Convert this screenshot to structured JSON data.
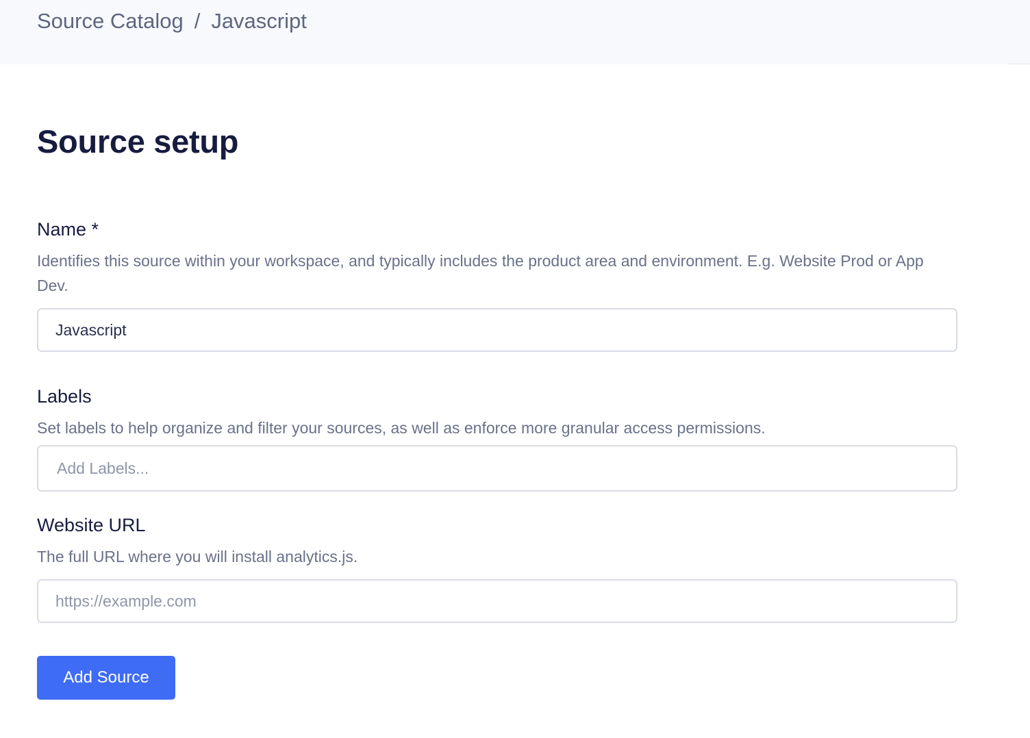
{
  "breadcrumb": {
    "parent": "Source Catalog",
    "separator": "/",
    "current": "Javascript"
  },
  "page": {
    "title": "Source setup"
  },
  "form": {
    "name": {
      "label": "Name *",
      "help": "Identifies this source within your workspace, and typically includes the product area and environment. E.g. Website Prod or App Dev.",
      "value": "Javascript"
    },
    "labels": {
      "label": "Labels",
      "help": "Set labels to help organize and filter your sources, as well as enforce more granular access permissions.",
      "placeholder": "Add Labels..."
    },
    "website_url": {
      "label": "Website URL",
      "help": "The full URL where you will install analytics.js.",
      "placeholder": "https://example.com"
    },
    "submit_label": "Add Source"
  },
  "colors": {
    "primary": "#3e6cf4",
    "heading": "#171c3f",
    "muted_text": "#6a7189",
    "topbar_bg": "#f8f9fd",
    "input_border": "#d9dce6"
  }
}
